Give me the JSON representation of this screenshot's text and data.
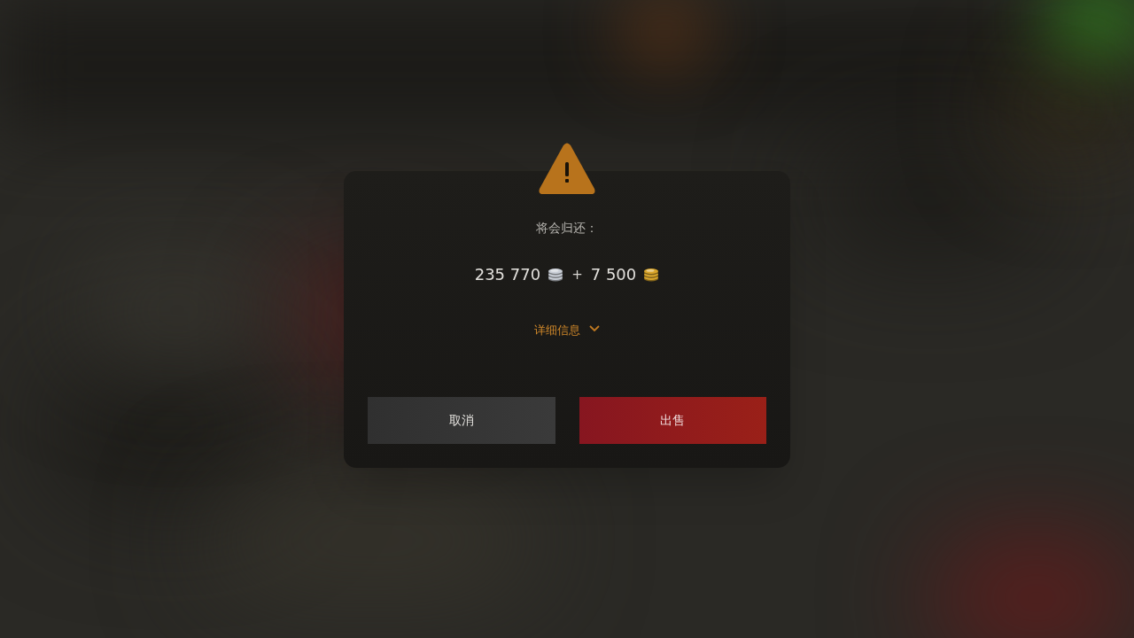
{
  "dialog": {
    "message": "将会归还：",
    "amounts": [
      {
        "value": "235 770",
        "color": "#c9ced6"
      },
      {
        "value": "7 500",
        "color": "#d9a52a"
      }
    ],
    "separator": "+",
    "details_link": {
      "label": "详细信息",
      "expanded": false
    },
    "buttons": [
      {
        "label": "取消",
        "kind": "secondary"
      },
      {
        "label": "出售",
        "kind": "primary"
      }
    ]
  }
}
